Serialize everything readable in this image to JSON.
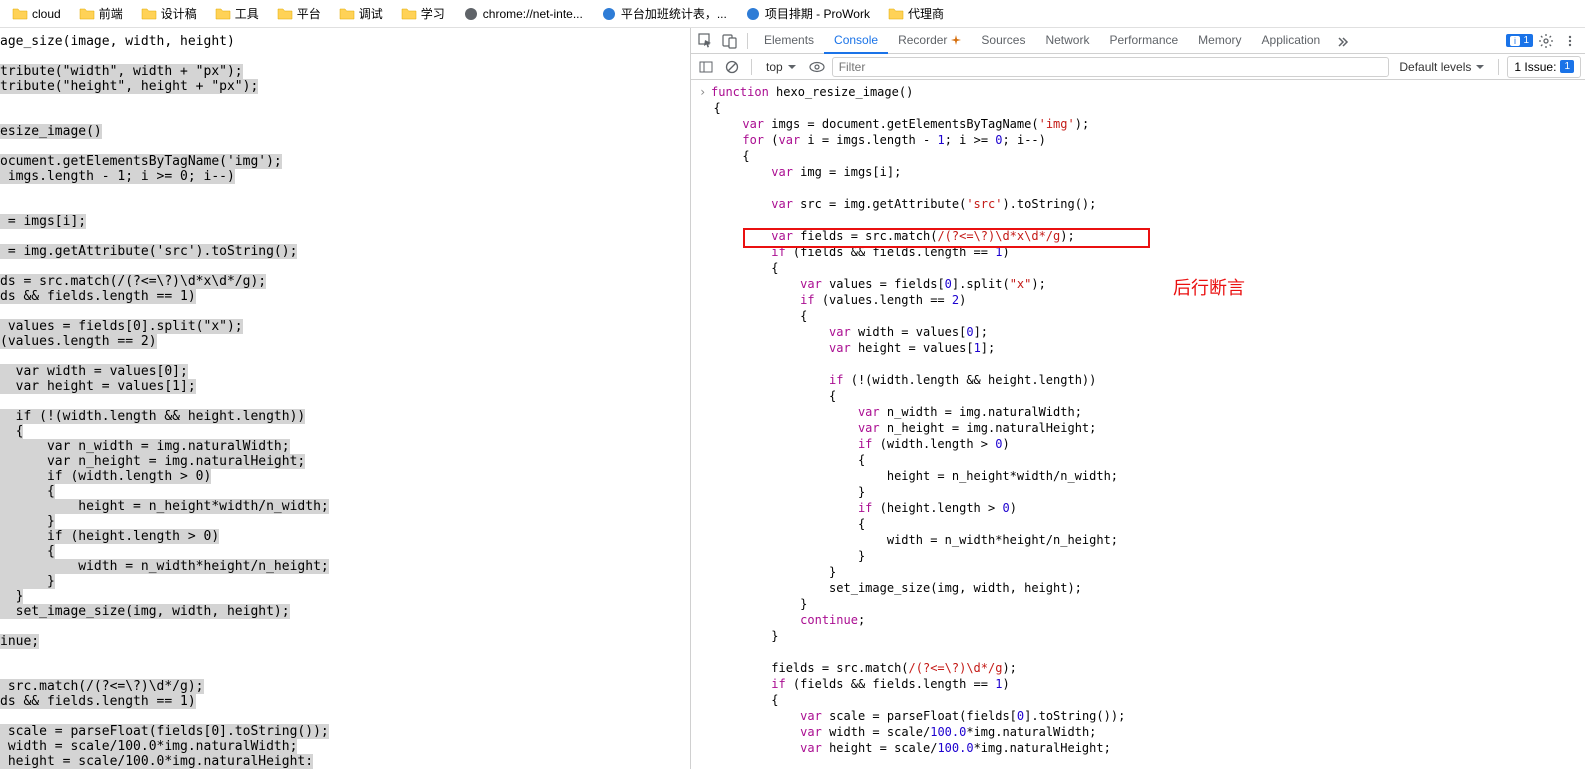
{
  "bookmarks": [
    {
      "type": "folder",
      "label": "cloud"
    },
    {
      "type": "folder",
      "label": "前端"
    },
    {
      "type": "folder",
      "label": "设计稿"
    },
    {
      "type": "folder",
      "label": "工具"
    },
    {
      "type": "folder",
      "label": "平台"
    },
    {
      "type": "folder",
      "label": "调试"
    },
    {
      "type": "folder",
      "label": "学习"
    },
    {
      "type": "page",
      "label": "chrome://net-inte...",
      "iconColor": "#5f6368"
    },
    {
      "type": "page",
      "label": "平台加班统计表，...",
      "iconColor": "#2e7cd6"
    },
    {
      "type": "page",
      "label": "项目排期 - ProWork",
      "iconColor": "#2e7cd6"
    },
    {
      "type": "folder",
      "label": "代理商"
    }
  ],
  "leftCode": [
    {
      "hl": false,
      "t": "age_size(image, width, height)"
    },
    {
      "hl": false,
      "t": ""
    },
    {
      "hl": true,
      "t": "tribute(\"width\", width + \"px\");"
    },
    {
      "hl": true,
      "t": "tribute(\"height\", height + \"px\");"
    },
    {
      "hl": false,
      "t": ""
    },
    {
      "hl": false,
      "t": ""
    },
    {
      "hl": true,
      "t": "esize_image()"
    },
    {
      "hl": false,
      "t": ""
    },
    {
      "hl": true,
      "t": "ocument.getElementsByTagName('img');"
    },
    {
      "hl": true,
      "t": " imgs.length - 1; i >= 0; i--)"
    },
    {
      "hl": false,
      "t": ""
    },
    {
      "hl": false,
      "t": ""
    },
    {
      "hl": true,
      "t": " = imgs[i];"
    },
    {
      "hl": false,
      "t": ""
    },
    {
      "hl": true,
      "t": " = img.getAttribute('src').toString();"
    },
    {
      "hl": false,
      "t": ""
    },
    {
      "hl": true,
      "t": "ds = src.match(/(?<=\\?)\\d*x\\d*/g);"
    },
    {
      "hl": true,
      "t": "ds && fields.length == 1)"
    },
    {
      "hl": false,
      "t": ""
    },
    {
      "hl": true,
      "t": " values = fields[0].split(\"x\");"
    },
    {
      "hl": true,
      "t": "(values.length == 2)"
    },
    {
      "hl": false,
      "t": ""
    },
    {
      "hl": true,
      "t": "  var width = values[0];"
    },
    {
      "hl": true,
      "t": "  var height = values[1];"
    },
    {
      "hl": false,
      "t": ""
    },
    {
      "hl": true,
      "t": "  if (!(width.length && height.length))"
    },
    {
      "hl": true,
      "t": "  {"
    },
    {
      "hl": true,
      "t": "      var n_width = img.naturalWidth;"
    },
    {
      "hl": true,
      "t": "      var n_height = img.naturalHeight;"
    },
    {
      "hl": true,
      "t": "      if (width.length > 0)"
    },
    {
      "hl": true,
      "t": "      {"
    },
    {
      "hl": true,
      "t": "          height = n_height*width/n_width;"
    },
    {
      "hl": true,
      "t": "      }"
    },
    {
      "hl": true,
      "t": "      if (height.length > 0)"
    },
    {
      "hl": true,
      "t": "      {"
    },
    {
      "hl": true,
      "t": "          width = n_width*height/n_height;"
    },
    {
      "hl": true,
      "t": "      }"
    },
    {
      "hl": true,
      "t": "  }"
    },
    {
      "hl": true,
      "t": "  set_image_size(img, width, height);"
    },
    {
      "hl": false,
      "t": ""
    },
    {
      "hl": true,
      "t": "inue;"
    },
    {
      "hl": false,
      "t": ""
    },
    {
      "hl": false,
      "t": ""
    },
    {
      "hl": true,
      "t": " src.match(/(?<=\\?)\\d*/g);"
    },
    {
      "hl": true,
      "t": "ds && fields.length == 1)"
    },
    {
      "hl": false,
      "t": ""
    },
    {
      "hl": true,
      "t": " scale = parseFloat(fields[0].toString());"
    },
    {
      "hl": true,
      "t": " width = scale/100.0*img.naturalWidth;"
    },
    {
      "hl": true,
      "t": " height = scale/100.0*img.naturalHeight:"
    }
  ],
  "devtools": {
    "tabs": [
      "Elements",
      "Console",
      "Recorder",
      "Sources",
      "Network",
      "Performance",
      "Memory",
      "Application"
    ],
    "activeTab": "Console",
    "badgeCount": "1",
    "toolbar": {
      "context": "top",
      "filterPlaceholder": "Filter",
      "levels": "Default levels",
      "issues": "1 Issue:",
      "issueCount": "1"
    },
    "annotation": "后行断言",
    "code": [
      "<span class='caret'>›</span><span class='kw'>function</span> hexo_resize_image()",
      "  {",
      "      <span class='kw'>var</span> imgs = document.getElementsByTagName(<span class='str'>'img'</span>);",
      "      <span class='kw'>for</span> (<span class='kw'>var</span> i = imgs.length - <span class='num'>1</span>; i &gt;= <span class='num'>0</span>; i--)",
      "      {",
      "          <span class='kw'>var</span> img = imgs[i];",
      "",
      "          <span class='kw'>var</span> src = img.getAttribute(<span class='str'>'src'</span>).toString();",
      "",
      "          <span class='kw'>var</span> fields = src.match(<span class='reg'>/(?&lt;=\\?)\\d*x\\d*/g</span>);",
      "          <span class='kw'>if</span> (fields &amp;&amp; fields.length == <span class='num'>1</span>)",
      "          {",
      "              <span class='kw'>var</span> values = fields[<span class='num'>0</span>].split(<span class='str'>\"x\"</span>);",
      "              <span class='kw'>if</span> (values.length == <span class='num'>2</span>)",
      "              {",
      "                  <span class='kw'>var</span> width = values[<span class='num'>0</span>];",
      "                  <span class='kw'>var</span> height = values[<span class='num'>1</span>];",
      "",
      "                  <span class='kw'>if</span> (!(width.length &amp;&amp; height.length))",
      "                  {",
      "                      <span class='kw'>var</span> n_width = img.naturalWidth;",
      "                      <span class='kw'>var</span> n_height = img.naturalHeight;",
      "                      <span class='kw'>if</span> (width.length &gt; <span class='num'>0</span>)",
      "                      {",
      "                          height = n_height*width/n_width;",
      "                      }",
      "                      <span class='kw'>if</span> (height.length &gt; <span class='num'>0</span>)",
      "                      {",
      "                          width = n_width*height/n_height;",
      "                      }",
      "                  }",
      "                  set_image_size(img, width, height);",
      "              }",
      "              <span class='kw'>continue</span>;",
      "          }",
      "",
      "          fields = src.match(<span class='reg'>/(?&lt;=\\?)\\d*/g</span>);",
      "          <span class='kw'>if</span> (fields &amp;&amp; fields.length == <span class='num'>1</span>)",
      "          {",
      "              <span class='kw'>var</span> scale = parseFloat(fields[<span class='num'>0</span>].toString());",
      "              <span class='kw'>var</span> width = scale/<span class='num'>100.0</span>*img.naturalWidth;",
      "              <span class='kw'>var</span> height = scale/<span class='num'>100.0</span>*img.naturalHeight;"
    ]
  }
}
